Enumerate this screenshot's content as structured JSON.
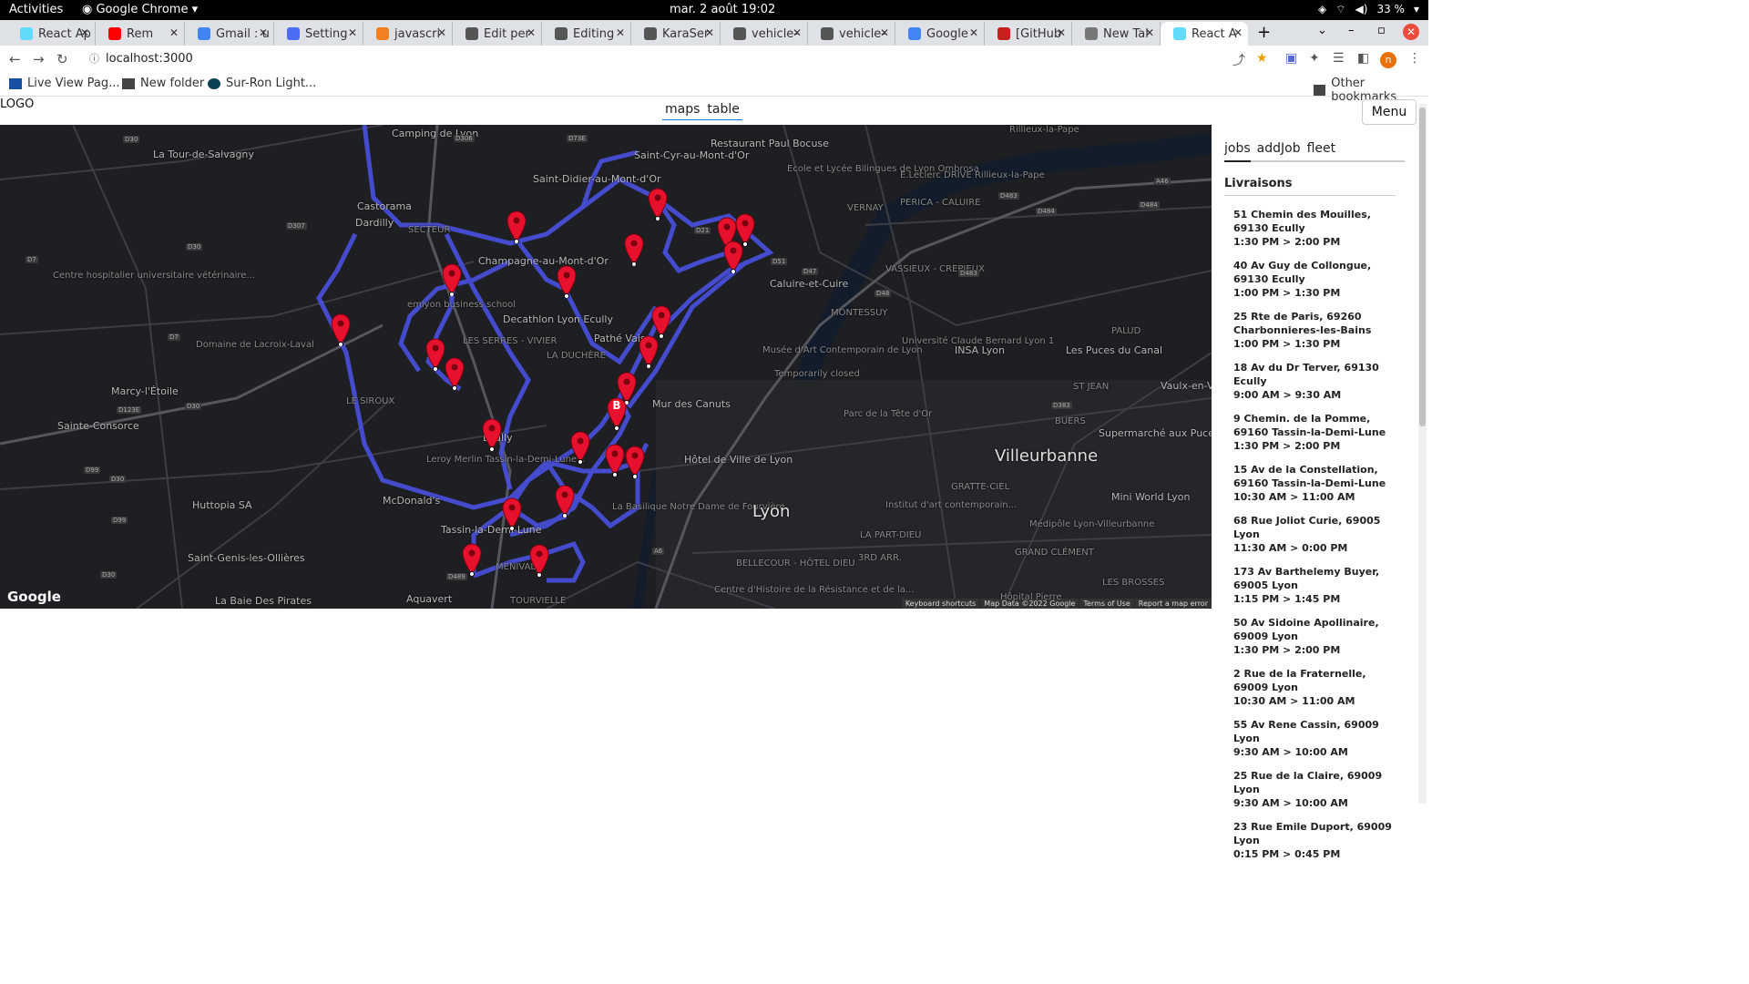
{
  "os": {
    "activities": "Activities",
    "app": "Google Chrome",
    "clock": "mar. 2 août  19:02",
    "battery": "33 %"
  },
  "browser": {
    "tabs": [
      {
        "title": "React Ap",
        "color": "#61dafb"
      },
      {
        "title": "Rem",
        "color": "#ff0000"
      },
      {
        "title": "Gmail : u",
        "color": "#4285f4"
      },
      {
        "title": "Setting",
        "color": "#4a6cf7"
      },
      {
        "title": "javascri",
        "color": "#f48024"
      },
      {
        "title": "Edit per",
        "color": "#555555"
      },
      {
        "title": "Editing",
        "color": "#555555"
      },
      {
        "title": "KaraSer",
        "color": "#555555"
      },
      {
        "title": "vehicle-",
        "color": "#555555"
      },
      {
        "title": "vehicle-",
        "color": "#555555"
      },
      {
        "title": "Google",
        "color": "#4285f4"
      },
      {
        "title": "[GitHub",
        "color": "#c5221f"
      },
      {
        "title": "New Tal",
        "color": "#777777"
      },
      {
        "title": "React A",
        "color": "#61dafb"
      }
    ],
    "url": "localhost:3000",
    "bookmarks": [
      "Live View Pag...",
      "New folder",
      "Sur-Ron Light..."
    ],
    "other_bookmarks": "Other bookmarks",
    "profile_initial": "n"
  },
  "app": {
    "logo": "LOGO",
    "view_tabs": [
      "maps",
      "table"
    ],
    "menu_label": "Menu"
  },
  "map": {
    "place_labels": [
      "La Tour-de-Salvagny",
      "Camping de Lyon",
      "Dardilly",
      "Castorama",
      "Saint-Didier-au-Mont-d'Or",
      "Saint-Cyr-au-Mont-d'Or",
      "Restaurant Paul Bocuse",
      "Ecole et Lycée Bilingues de Lyon Ombrosa",
      "E.Leclerc DRIVE Rillieux-la-Pape",
      "Rillieux-la-Pape",
      "Champagne-au-Mont-d'Or",
      "Centre hospitalier universitaire vétérinaire...",
      "emlyon business school",
      "Decathlon Lyon Ecully",
      "Caluire-et-Cuire",
      "VASSIEUX - CREPIEUX",
      "MONTESSUY",
      "Domaine de Lacroix-Laval",
      "LES SERRES - VIVIER",
      "LA DUCHÈRE",
      "Pathé Vaise",
      "Musée d'Art Contemporain de Lyon",
      "Temporarily closed",
      "Université Claude Bernard Lyon 1",
      "INSA Lyon",
      "Les Puces du Canal",
      "PALUD",
      "Marcy-l'Étoile",
      "LE SIROUX",
      "Mur des Canuts",
      "Parc de la Tête d'Or",
      "ST JEAN",
      "Vaulx-en-Ve",
      "Sainte-Consorce",
      "Ecully",
      "BUERS",
      "Leroy Merlin Tassin-la-Demi-Lune...",
      "Hôtel de Ville de Lyon",
      "Villeurbanne",
      "Supermarché aux Puces",
      "Huttopia SA",
      "McDonald's",
      "La Basilique Notre Dame de Fourvière",
      "Lyon",
      "GRATTE-CIEL",
      "Mini World Lyon",
      "Institut d'art contemporain...",
      "Tassin-la-Demi-Lune",
      "Médipôle Lyon-Villeurbanne",
      "Saint-Genis-les-Ollières",
      "MENIVAL",
      "3RD ARR.",
      "GRAND CLÉMENT",
      "BELLECOUR - HÔTEL DIEU",
      "LA PART-DIEU",
      "LES BROSSES",
      "La Baie Des Pirates",
      "Aquavert",
      "TOURVIELLE",
      "Centre d'Histoire de la Résistance et de la...",
      "Hôpital Pierre",
      "SECTEUR",
      "PERICA - CALUIRE",
      "VERNAY"
    ],
    "road_badges": [
      "D30",
      "D306",
      "D73E",
      "D307",
      "D7",
      "D30",
      "D7",
      "D30",
      "D123E",
      "D99",
      "D30",
      "D99",
      "D30",
      "D489",
      "A6",
      "D21",
      "D51",
      "D47",
      "D48",
      "D483",
      "D484",
      "D484",
      "A46",
      "D383",
      "D483"
    ],
    "google": "Google",
    "footer": [
      "Keyboard shortcuts",
      "Map Data ©2022 Google",
      "Terms of Use",
      "Report a map error"
    ],
    "base_marker_label": "B",
    "marker_color": "#e8112d",
    "route_color": "#4a50e0"
  },
  "sidebar": {
    "tabs": [
      "jobs",
      "addJob",
      "fleet"
    ],
    "title": "Livraisons",
    "jobs": [
      {
        "address": "51 Chemin des Mouilles, 69130 Ecully",
        "time": "1:30 PM > 2:00 PM"
      },
      {
        "address": "40 Av Guy de Collongue, 69130 Ecully",
        "time": "1:00 PM > 1:30 PM"
      },
      {
        "address": "25 Rte de Paris, 69260 Charbonnieres-les-Bains",
        "time": "1:00 PM > 1:30 PM"
      },
      {
        "address": "18 Av du Dr Terver, 69130 Ecully",
        "time": "9:00 AM > 9:30 AM"
      },
      {
        "address": "9 Chemin. de la Pomme, 69160 Tassin-la-Demi-Lune",
        "time": "1:30 PM > 2:00 PM"
      },
      {
        "address": "15 Av de la Constellation, 69160 Tassin-la-Demi-Lune",
        "time": "10:30 AM > 11:00 AM"
      },
      {
        "address": "68 Rue Joliot Curie, 69005 Lyon",
        "time": "11:30 AM > 0:00 PM"
      },
      {
        "address": "173 Av Barthelemy Buyer, 69005 Lyon",
        "time": "1:15 PM > 1:45 PM"
      },
      {
        "address": "50 Av Sidoine Apollinaire, 69009 Lyon",
        "time": "1:30 PM > 2:00 PM"
      },
      {
        "address": "2 Rue de la Fraternelle, 69009 Lyon",
        "time": "10:30 AM > 11:00 AM"
      },
      {
        "address": "55 Av Rene Cassin, 69009 Lyon",
        "time": "9:30 AM > 10:00 AM"
      },
      {
        "address": "25 Rue de la Claire, 69009 Lyon",
        "time": "9:30 AM > 10:00 AM"
      },
      {
        "address": "23 Rue Emile Duport, 69009 Lyon",
        "time": "0:15 PM > 0:45 PM"
      }
    ]
  }
}
